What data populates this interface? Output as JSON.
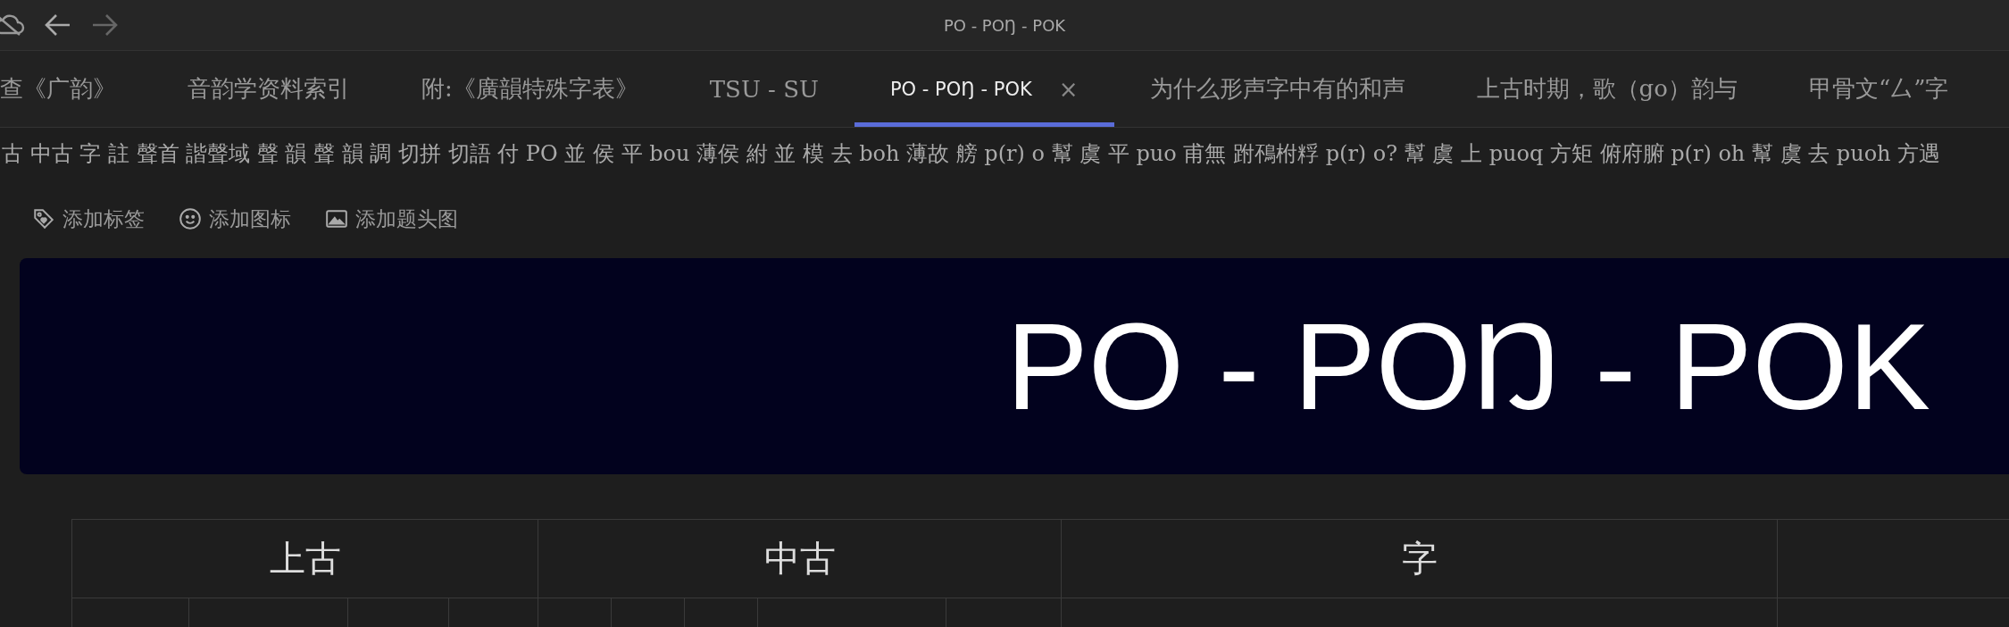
{
  "window": {
    "title": "PO - POŊ - POK"
  },
  "tabs": [
    {
      "label": "查《广韵》",
      "selected": false
    },
    {
      "label": "音韵学资料索引",
      "selected": false
    },
    {
      "label": "附:《廣韻特殊字表》",
      "selected": false
    },
    {
      "label": "TSU - SU",
      "selected": false
    },
    {
      "label": "PO - POŊ - POK",
      "selected": true,
      "close": "×"
    },
    {
      "label": "为什么形声字中有的和声",
      "selected": false
    },
    {
      "label": "上古时期，歌（go）韵与",
      "selected": false
    },
    {
      "label": "甲骨文“厶”字",
      "selected": false
    }
  ],
  "outline_text": "古 中古 字 註 聲首 諧聲域 聲 韻 聲 韻 調 切拼 切語 付 PO 並 侯 平 bou 薄侯 紨 並 模 去 boh 薄故 艕 p(r) o 幫 虞 平 puo 甫無 跗鴀柎粰 p(r) o? 幫 虞 上 puoq 方矩 俯府腑 p(r) oh 幫 虞 去 puoh 方遇",
  "actions": [
    {
      "kind": "tag",
      "label": "添加标签"
    },
    {
      "kind": "emoji",
      "label": "添加图标"
    },
    {
      "kind": "image",
      "label": "添加题头图"
    }
  ],
  "cover": {
    "title": "PO - POŊ - POK"
  },
  "table": {
    "groups": [
      {
        "label": "上古"
      },
      {
        "label": "中古"
      },
      {
        "label": "字"
      }
    ]
  }
}
